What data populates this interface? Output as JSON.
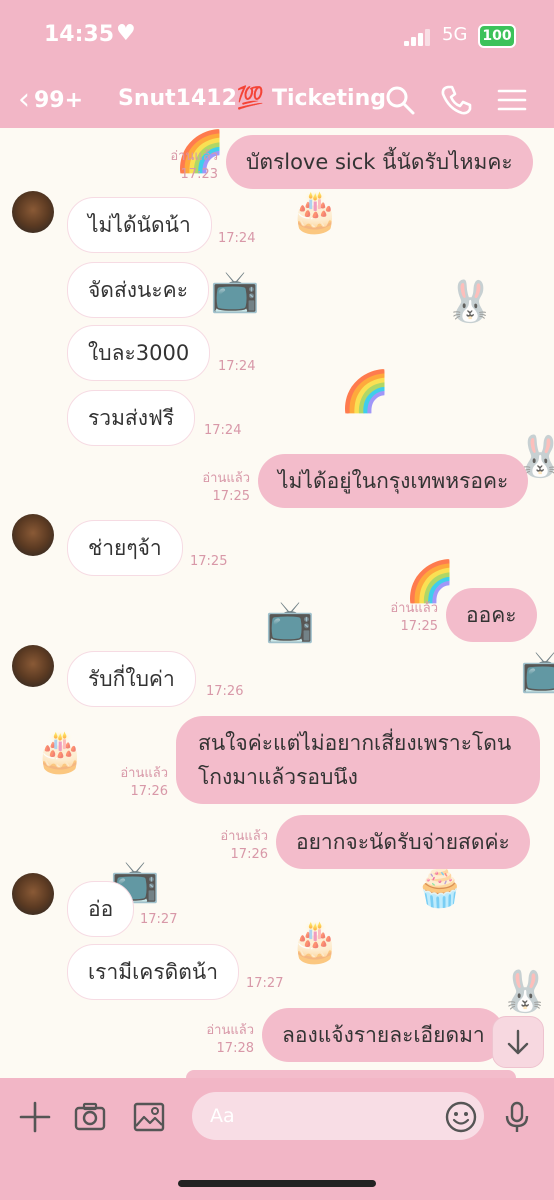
{
  "status_bar": {
    "time": "14:35",
    "network": "5G",
    "battery": "100"
  },
  "header": {
    "back_count": "99+",
    "title": "Snut1412💯 Ticketing"
  },
  "messages": [
    {
      "side": "out",
      "text": "บัตรlove sick นี้นัดรับไหมคะ",
      "read": "อ่านแล้ว",
      "time": "17:23"
    },
    {
      "side": "in",
      "text": "ไม่ได้นัดน้า",
      "time": "17:24"
    },
    {
      "side": "in",
      "text": "จัดส่งนะคะ",
      "time": ""
    },
    {
      "side": "in",
      "text": "ใบละ3000",
      "time": "17:24"
    },
    {
      "side": "in",
      "text": "รวมส่งฟรี",
      "time": "17:24"
    },
    {
      "side": "out",
      "text": "ไม่ได้อยู่ในกรุงเทพหรอคะ",
      "read": "อ่านแล้ว",
      "time": "17:25"
    },
    {
      "side": "in",
      "text": "ช่ายๆจ้า",
      "time": "17:25"
    },
    {
      "side": "out",
      "text": "ออคะ",
      "read": "อ่านแล้ว",
      "time": "17:25"
    },
    {
      "side": "in",
      "text": "รับกี่ใบค่า",
      "time": "17:26"
    },
    {
      "side": "out",
      "text": "สนใจค่ะแต่ไม่อยากเสี่ยงเพราะโดนโกงมาแล้วรอบนึง",
      "read": "อ่านแล้ว",
      "time": "17:26"
    },
    {
      "side": "out",
      "text": "อยากจะนัดรับจ่ายสดค่ะ",
      "read": "อ่านแล้ว",
      "time": "17:26"
    },
    {
      "side": "in",
      "text": "อ่อ",
      "time": "17:27"
    },
    {
      "side": "in",
      "text": "เรามีเครดิตน้า",
      "time": "17:27"
    },
    {
      "side": "out",
      "text": "ลองแจ้งรายละเอียดมา",
      "read": "อ่านแล้ว",
      "time": "17:28"
    }
  ],
  "composer": {
    "placeholder": "Aa"
  },
  "icons": {
    "header": [
      "back-icon",
      "search-icon",
      "phone-icon",
      "menu-icon"
    ],
    "composer": [
      "plus-icon",
      "camera-icon",
      "image-icon",
      "emoji-icon",
      "microphone-icon"
    ]
  }
}
